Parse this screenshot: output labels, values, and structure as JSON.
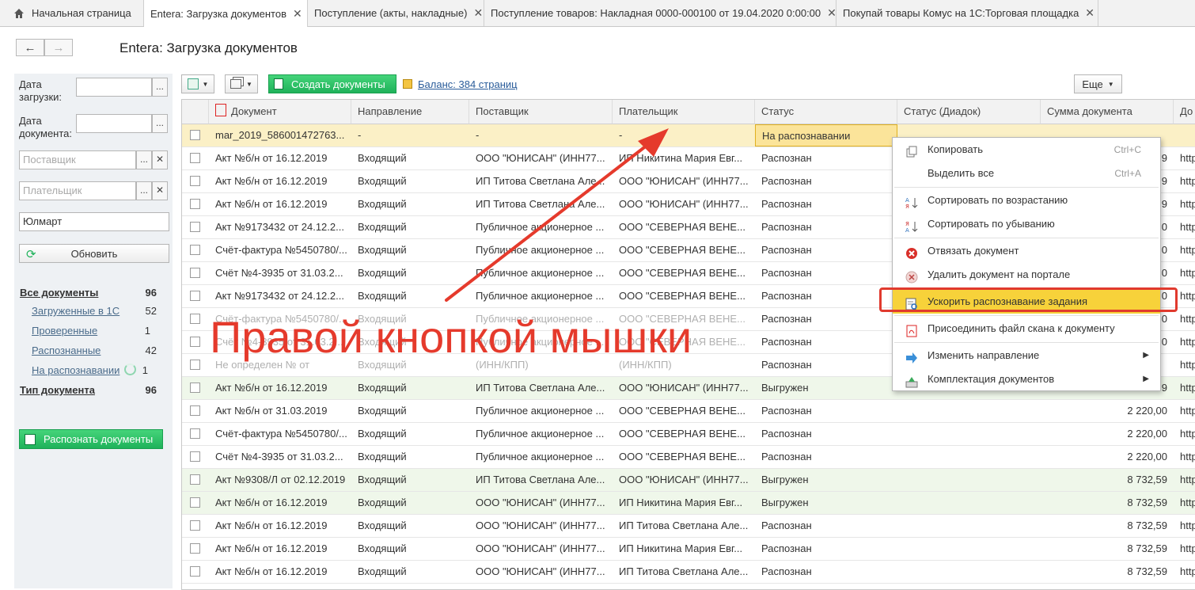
{
  "tabs": [
    {
      "label": "Начальная страница",
      "closable": false
    },
    {
      "label": "Entera: Загрузка документов",
      "closable": true
    },
    {
      "label": "Поступление (акты, накладные)",
      "closable": true
    },
    {
      "label": "Поступление товаров: Накладная 0000-000100 от 19.04.2020 0:00:00",
      "closable": true
    },
    {
      "label": "Покупай товары Комус на 1С:Торговая площадка",
      "closable": true
    }
  ],
  "page_title": "Entera: Загрузка документов",
  "filters": {
    "upload_date_label": "Дата загрузки:",
    "doc_date_label": "Дата документа:",
    "supplier_placeholder": "Поставщик",
    "payer_placeholder": "Плательщик",
    "search_value": "Юлмарт",
    "refresh_label": "Обновить"
  },
  "nav": {
    "all_docs": {
      "label": "Все документы",
      "count": "96"
    },
    "sub": [
      {
        "label": "Загруженные в 1С",
        "count": "52"
      },
      {
        "label": "Проверенные",
        "count": "1"
      },
      {
        "label": "Распознанные",
        "count": "42"
      },
      {
        "label": "На распознавании",
        "count": "1"
      }
    ],
    "doc_type": {
      "label": "Тип документа",
      "count": "96"
    }
  },
  "recognize_button": "Распознать документы",
  "toolbar": {
    "create_label": "Создать документы",
    "balance_label": "Баланс: 384 страниц",
    "more_label": "Еще"
  },
  "columns": [
    "Документ",
    "Направление",
    "Поставщик",
    "Плательщик",
    "Статус",
    "Статус (Диадок)",
    "Сумма документа",
    "До"
  ],
  "rows": [
    {
      "doc": "mar_2019_586001472763...",
      "dir": "-",
      "supplier": "-",
      "payer": "-",
      "status": "На распознавании",
      "diadoc": "",
      "sum": "",
      "link": "",
      "style": "sel"
    },
    {
      "doc": "Акт №б/н от 16.12.2019",
      "dir": "Входящий",
      "supplier": "ООО \"ЮНИСАН\" (ИНН77...",
      "payer": "ИП Никитина Мария Евг...",
      "status": "Распознан",
      "diadoc": "",
      "sum": "9",
      "link": "http",
      "style": ""
    },
    {
      "doc": "Акт №б/н от 16.12.2019",
      "dir": "Входящий",
      "supplier": "ИП Титова Светлана Але...",
      "payer": "ООО \"ЮНИСАН\" (ИНН77...",
      "status": "Распознан",
      "diadoc": "",
      "sum": "9",
      "link": "http",
      "style": ""
    },
    {
      "doc": "Акт №б/н от 16.12.2019",
      "dir": "Входящий",
      "supplier": "ИП Титова Светлана Але...",
      "payer": "ООО \"ЮНИСАН\" (ИНН77...",
      "status": "Распознан",
      "diadoc": "",
      "sum": "9",
      "link": "http",
      "style": ""
    },
    {
      "doc": "Акт №9173432 от 24.12.2...",
      "dir": "Входящий",
      "supplier": "Публичное акционерное ...",
      "payer": "ООО \"СЕВЕРНАЯ ВЕНЕ...",
      "status": "Распознан",
      "diadoc": "",
      "sum": "0",
      "link": "http",
      "style": ""
    },
    {
      "doc": "Счёт-фактура №5450780/...",
      "dir": "Входящий",
      "supplier": "Публичное акционерное ...",
      "payer": "ООО \"СЕВЕРНАЯ ВЕНЕ...",
      "status": "Распознан",
      "diadoc": "",
      "sum": "0",
      "link": "http",
      "style": ""
    },
    {
      "doc": "Счёт №4-3935 от 31.03.2...",
      "dir": "Входящий",
      "supplier": "Публичное акционерное ...",
      "payer": "ООО \"СЕВЕРНАЯ ВЕНЕ...",
      "status": "Распознан",
      "diadoc": "",
      "sum": "0",
      "link": "http",
      "style": ""
    },
    {
      "doc": "Акт №9173432 от 24.12.2...",
      "dir": "Входящий",
      "supplier": "Публичное акционерное ...",
      "payer": "ООО \"СЕВЕРНАЯ ВЕНЕ...",
      "status": "Распознан",
      "diadoc": "",
      "sum": "0",
      "link": "http",
      "style": ""
    },
    {
      "doc": "Счёт-фактура №5450780/...",
      "dir": "Входящий",
      "supplier": "Публичное акционерное ...",
      "payer": "ООО \"СЕВЕРНАЯ ВЕНЕ...",
      "status": "Распознан",
      "diadoc": "",
      "sum": "0",
      "link": "http",
      "style": "faded"
    },
    {
      "doc": "Счёт №4-3935 от 31.03.2...",
      "dir": "Входящий",
      "supplier": "Публичное акционерное ...",
      "payer": "ООО \"СЕВЕРНАЯ ВЕНЕ...",
      "status": "Распознан",
      "diadoc": "",
      "sum": "0",
      "link": "http",
      "style": "faded"
    },
    {
      "doc": "Не определен № от",
      "dir": "Входящий",
      "supplier": "(ИНН/КПП)",
      "payer": "(ИНН/КПП)",
      "status": "Распознан",
      "diadoc": "",
      "sum": "",
      "link": "http",
      "style": "faded"
    },
    {
      "doc": "Акт №б/н от 16.12.2019",
      "dir": "Входящий",
      "supplier": "ИП Титова Светлана Але...",
      "payer": "ООО \"ЮНИСАН\" (ИНН77...",
      "status": "Выгружен",
      "diadoc": "",
      "sum": "9",
      "link": "http",
      "style": "green"
    },
    {
      "doc": "Акт №б/н от 31.03.2019",
      "dir": "Входящий",
      "supplier": "Публичное акционерное ...",
      "payer": "ООО \"СЕВЕРНАЯ ВЕНЕ...",
      "status": "Распознан",
      "diadoc": "",
      "sum": "2 220,00",
      "link": "http",
      "style": ""
    },
    {
      "doc": "Счёт-фактура №5450780/...",
      "dir": "Входящий",
      "supplier": "Публичное акционерное ...",
      "payer": "ООО \"СЕВЕРНАЯ ВЕНЕ...",
      "status": "Распознан",
      "diadoc": "",
      "sum": "2 220,00",
      "link": "http",
      "style": ""
    },
    {
      "doc": "Счёт №4-3935 от 31.03.2...",
      "dir": "Входящий",
      "supplier": "Публичное акционерное ...",
      "payer": "ООО \"СЕВЕРНАЯ ВЕНЕ...",
      "status": "Распознан",
      "diadoc": "",
      "sum": "2 220,00",
      "link": "http",
      "style": ""
    },
    {
      "doc": "Акт №9308/Л от 02.12.2019",
      "dir": "Входящий",
      "supplier": "ИП Титова Светлана Але...",
      "payer": "ООО \"ЮНИСАН\" (ИНН77...",
      "status": "Выгружен",
      "diadoc": "",
      "sum": "8 732,59",
      "link": "http",
      "style": "green"
    },
    {
      "doc": "Акт №б/н от 16.12.2019",
      "dir": "Входящий",
      "supplier": "ООО \"ЮНИСАН\" (ИНН77...",
      "payer": "ИП Никитина Мария Евг...",
      "status": "Выгружен",
      "diadoc": "",
      "sum": "8 732,59",
      "link": "http",
      "style": "green"
    },
    {
      "doc": "Акт №б/н от 16.12.2019",
      "dir": "Входящий",
      "supplier": "ООО \"ЮНИСАН\" (ИНН77...",
      "payer": "ИП Титова Светлана Але...",
      "status": "Распознан",
      "diadoc": "",
      "sum": "8 732,59",
      "link": "http",
      "style": ""
    },
    {
      "doc": "Акт №б/н от 16.12.2019",
      "dir": "Входящий",
      "supplier": "ООО \"ЮНИСАН\" (ИНН77...",
      "payer": "ИП Никитина Мария Евг...",
      "status": "Распознан",
      "diadoc": "",
      "sum": "8 732,59",
      "link": "http",
      "style": ""
    },
    {
      "doc": "Акт №б/н от 16.12.2019",
      "dir": "Входящий",
      "supplier": "ООО \"ЮНИСАН\" (ИНН77...",
      "payer": "ИП Титова Светлана Але...",
      "status": "Распознан",
      "diadoc": "",
      "sum": "8 732,59",
      "link": "http",
      "style": ""
    }
  ],
  "context_menu": [
    {
      "label": "Копировать",
      "shortcut": "Ctrl+C",
      "icon": "copy-icon"
    },
    {
      "label": "Выделить все",
      "shortcut": "Ctrl+A",
      "icon": ""
    },
    {
      "label": "Сортировать по возрастанию",
      "shortcut": "",
      "icon": "sort-asc-icon"
    },
    {
      "label": "Сортировать по убыванию",
      "shortcut": "",
      "icon": "sort-desc-icon"
    },
    {
      "label": "Отвязать документ",
      "shortcut": "",
      "icon": "unlink-icon"
    },
    {
      "label": "Удалить документ на портале",
      "shortcut": "",
      "icon": "delete-icon"
    },
    {
      "label": "Ускорить распознавание задания",
      "shortcut": "",
      "icon": "speed-up-icon"
    },
    {
      "label": "Присоединить файл скана к документу",
      "shortcut": "",
      "icon": "pdf-icon"
    },
    {
      "label": "Изменить направление",
      "shortcut": "",
      "icon": "direction-icon",
      "submenu": true
    },
    {
      "label": "Комплектация документов",
      "shortcut": "",
      "icon": "package-icon",
      "submenu": true
    }
  ],
  "annotation": "Правой кнопкой мышки",
  "colors": {
    "accent_green": "#1fb25a",
    "highlight_yellow": "#f7d23a",
    "annotation_red": "#e53a2c",
    "selected_row": "#fbf0c6"
  }
}
